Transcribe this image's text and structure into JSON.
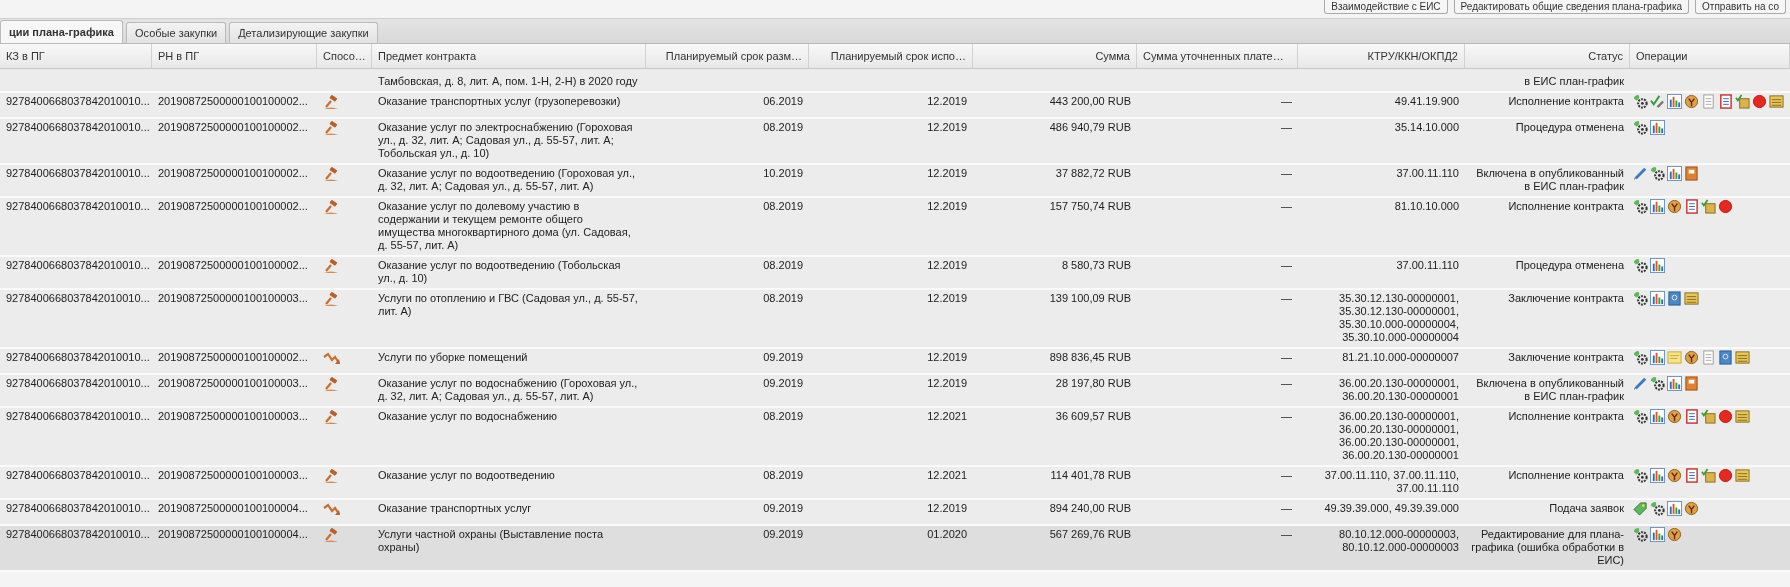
{
  "toolbar": {
    "buttons": [
      "Взаимодействие с ЕИС",
      "Редактировать общие сведения плана-графика",
      "Отправить на со"
    ]
  },
  "tabs": [
    {
      "label": "ции плана-графика",
      "selected": true
    },
    {
      "label": "Особые закупки",
      "selected": false
    },
    {
      "label": "Детализирующие закупки",
      "selected": false
    }
  ],
  "table": {
    "columns": [
      "КЗ в ПГ",
      "РН в ПГ",
      "Спосо…",
      "Предмет контракта",
      "Планируемый срок разм…",
      "Планируемый срок испо…",
      "Сумма",
      "Сумма уточненных плате…",
      "КТРУ/ККН/ОКПД2",
      "Статус",
      "Операции"
    ],
    "partial_row": {
      "subject": "Тамбовская, д. 8, лит. А, пом. 1-Н, 2-Н) в 2020 году",
      "status": "в ЕИС план-график"
    },
    "rows": [
      {
        "ikz": "9278400668037842010010...",
        "rn": "20190872500000100100002...",
        "method": {
          "kind": "auction"
        },
        "subject": "Оказание транспортных услуг (грузоперевозки)",
        "placement": "06.2019",
        "execution": "12.2019",
        "sum": "443 200,00 RUB",
        "refined": "—",
        "ktru": "49.41.19.900",
        "status": "Исполнение контракта",
        "operations": [
          {
            "kind": "gear"
          },
          {
            "kind": "check"
          },
          {
            "kind": "chart"
          },
          {
            "kind": "emblem"
          },
          {
            "kind": "doc"
          },
          {
            "kind": "notebook"
          },
          {
            "kind": "scrollcheck"
          },
          {
            "kind": "stop"
          },
          {
            "kind": "scroll"
          }
        ],
        "selected": false
      },
      {
        "ikz": "9278400668037842010010...",
        "rn": "20190872500000100100002...",
        "method": {
          "kind": "auction"
        },
        "subject": "Оказание услуг по электроснабжению (Гороховая ул., д. 32, лит. А; Садовая ул., д. 55-57, лит. А; Тобольская ул., д. 10)",
        "placement": "08.2019",
        "execution": "12.2019",
        "sum": "486 940,79 RUB",
        "refined": "—",
        "ktru": "35.14.10.000",
        "status": "Процедура отменена",
        "operations": [
          {
            "kind": "gear"
          },
          {
            "kind": "chart"
          }
        ],
        "selected": false
      },
      {
        "ikz": "9278400668037842010010...",
        "rn": "20190872500000100100002...",
        "method": {
          "kind": "auction"
        },
        "subject": "Оказание услуг по водоотведению (Гороховая ул., д. 32, лит. А; Садовая ул., д. 55-57, лит. А)",
        "placement": "10.2019",
        "execution": "12.2019",
        "sum": "37 882,72 RUB",
        "refined": "—",
        "ktru": "37.00.11.110",
        "status": "Включена в опубликованный в ЕИС план-график",
        "operations": [
          {
            "kind": "pencil"
          },
          {
            "kind": "gear"
          },
          {
            "kind": "chart"
          },
          {
            "kind": "book"
          }
        ],
        "selected": false
      },
      {
        "ikz": "9278400668037842010010...",
        "rn": "20190872500000100100002...",
        "method": {
          "kind": "auction"
        },
        "subject": "Оказание услуг по долевому участию в содержании и текущем ремонте общего имущества многоквартирного дома (ул. Садовая, д. 55-57, лит. А)",
        "placement": "08.2019",
        "execution": "12.2019",
        "sum": "157 750,74 RUB",
        "refined": "—",
        "ktru": "81.10.10.000",
        "status": "Исполнение контракта",
        "operations": [
          {
            "kind": "gear"
          },
          {
            "kind": "chart"
          },
          {
            "kind": "emblem"
          },
          {
            "kind": "notebook"
          },
          {
            "kind": "scrollcheck"
          },
          {
            "kind": "stop"
          }
        ],
        "selected": false
      },
      {
        "ikz": "9278400668037842010010...",
        "rn": "20190872500000100100002...",
        "method": {
          "kind": "auction"
        },
        "subject": "Оказание услуг по водоотведению (Тобольская ул., д. 10)",
        "placement": "08.2019",
        "execution": "12.2019",
        "sum": "8 580,73 RUB",
        "refined": "—",
        "ktru": "37.00.11.110",
        "status": "Процедура отменена",
        "operations": [
          {
            "kind": "gear"
          },
          {
            "kind": "chart"
          }
        ],
        "selected": false
      },
      {
        "ikz": "9278400668037842010010...",
        "rn": "20190872500000100100003...",
        "method": {
          "kind": "auction"
        },
        "subject": "Услуги по отоплению и ГВС (Садовая ул., д. 55-57, лит. А)",
        "placement": "08.2019",
        "execution": "12.2019",
        "sum": "139 100,09 RUB",
        "refined": "—",
        "ktru": "35.30.12.130-00000001, 35.30.12.130-00000001, 35.30.10.000-00000004, 35.30.10.000-00000004",
        "status": "Заключение контракта",
        "operations": [
          {
            "kind": "gear"
          },
          {
            "kind": "chart"
          },
          {
            "kind": "page"
          },
          {
            "kind": "scroll"
          }
        ],
        "selected": false
      },
      {
        "ikz": "9278400668037842010010...",
        "rn": "20190872500000100100002...",
        "method": {
          "kind": "other"
        },
        "subject": "Услуги по уборке помещений",
        "placement": "09.2019",
        "execution": "12.2019",
        "sum": "898 836,45 RUB",
        "refined": "—",
        "ktru": "81.21.10.000-00000007",
        "status": "Заключение контракта",
        "operations": [
          {
            "kind": "gear"
          },
          {
            "kind": "chart"
          },
          {
            "kind": "note"
          },
          {
            "kind": "emblem"
          },
          {
            "kind": "doc"
          },
          {
            "kind": "page"
          },
          {
            "kind": "scroll"
          }
        ],
        "selected": false
      },
      {
        "ikz": "9278400668037842010010...",
        "rn": "20190872500000100100003...",
        "method": {
          "kind": "auction"
        },
        "subject": "Оказание услуг по водоснабжению (Гороховая ул., д. 32, лит. А; Садовая ул., д. 55-57, лит. А)",
        "placement": "09.2019",
        "execution": "12.2019",
        "sum": "28 197,80 RUB",
        "refined": "—",
        "ktru": "36.00.20.130-00000001, 36.00.20.130-00000001",
        "status": "Включена в опубликованный в ЕИС план-график",
        "operations": [
          {
            "kind": "pencil"
          },
          {
            "kind": "gear"
          },
          {
            "kind": "chart"
          },
          {
            "kind": "book"
          }
        ],
        "selected": false
      },
      {
        "ikz": "9278400668037842010010...",
        "rn": "20190872500000100100003...",
        "method": {
          "kind": "auction"
        },
        "subject": "Оказание услуг по водоснабжению",
        "placement": "08.2019",
        "execution": "12.2021",
        "sum": "36 609,57 RUB",
        "refined": "—",
        "ktru": "36.00.20.130-00000001, 36.00.20.130-00000001, 36.00.20.130-00000001, 36.00.20.130-00000001",
        "status": "Исполнение контракта",
        "operations": [
          {
            "kind": "gear"
          },
          {
            "kind": "chart"
          },
          {
            "kind": "emblem"
          },
          {
            "kind": "notebook"
          },
          {
            "kind": "scrollcheck"
          },
          {
            "kind": "stop"
          },
          {
            "kind": "scroll"
          }
        ],
        "selected": false
      },
      {
        "ikz": "9278400668037842010010...",
        "rn": "20190872500000100100003...",
        "method": {
          "kind": "auction"
        },
        "subject": "Оказание услуг по водоотведению",
        "placement": "08.2019",
        "execution": "12.2021",
        "sum": "114 401,78 RUB",
        "refined": "—",
        "ktru": "37.00.11.110, 37.00.11.110, 37.00.11.110",
        "status": "Исполнение контракта",
        "operations": [
          {
            "kind": "gear"
          },
          {
            "kind": "chart"
          },
          {
            "kind": "emblem"
          },
          {
            "kind": "notebook"
          },
          {
            "kind": "scrollcheck"
          },
          {
            "kind": "stop"
          },
          {
            "kind": "scroll"
          }
        ],
        "selected": false
      },
      {
        "ikz": "9278400668037842010010...",
        "rn": "20190872500000100100004...",
        "method": {
          "kind": "other"
        },
        "subject": "Оказание транспортных услуг",
        "placement": "09.2019",
        "execution": "12.2019",
        "sum": "894 240,00 RUB",
        "refined": "—",
        "ktru": "49.39.39.000, 49.39.39.000",
        "status": "Подача заявок",
        "operations": [
          {
            "kind": "tag"
          },
          {
            "kind": "gear"
          },
          {
            "kind": "chart"
          },
          {
            "kind": "emblem"
          }
        ],
        "selected": false
      },
      {
        "ikz": "9278400668037842010010...",
        "rn": "20190872500000100100004...",
        "method": {
          "kind": "auction"
        },
        "subject": "Услуги частной охраны (Выставление поста охраны)",
        "placement": "09.2019",
        "execution": "01.2020",
        "sum": "567 269,76 RUB",
        "refined": "—",
        "ktru": "80.10.12.000-00000003, 80.10.12.000-00000003",
        "status": "Редактирование для плана-графика (ошибка обработки в ЕИС)",
        "operations": [
          {
            "kind": "gear"
          },
          {
            "kind": "chart"
          },
          {
            "kind": "emblem"
          }
        ],
        "selected": true
      }
    ]
  }
}
